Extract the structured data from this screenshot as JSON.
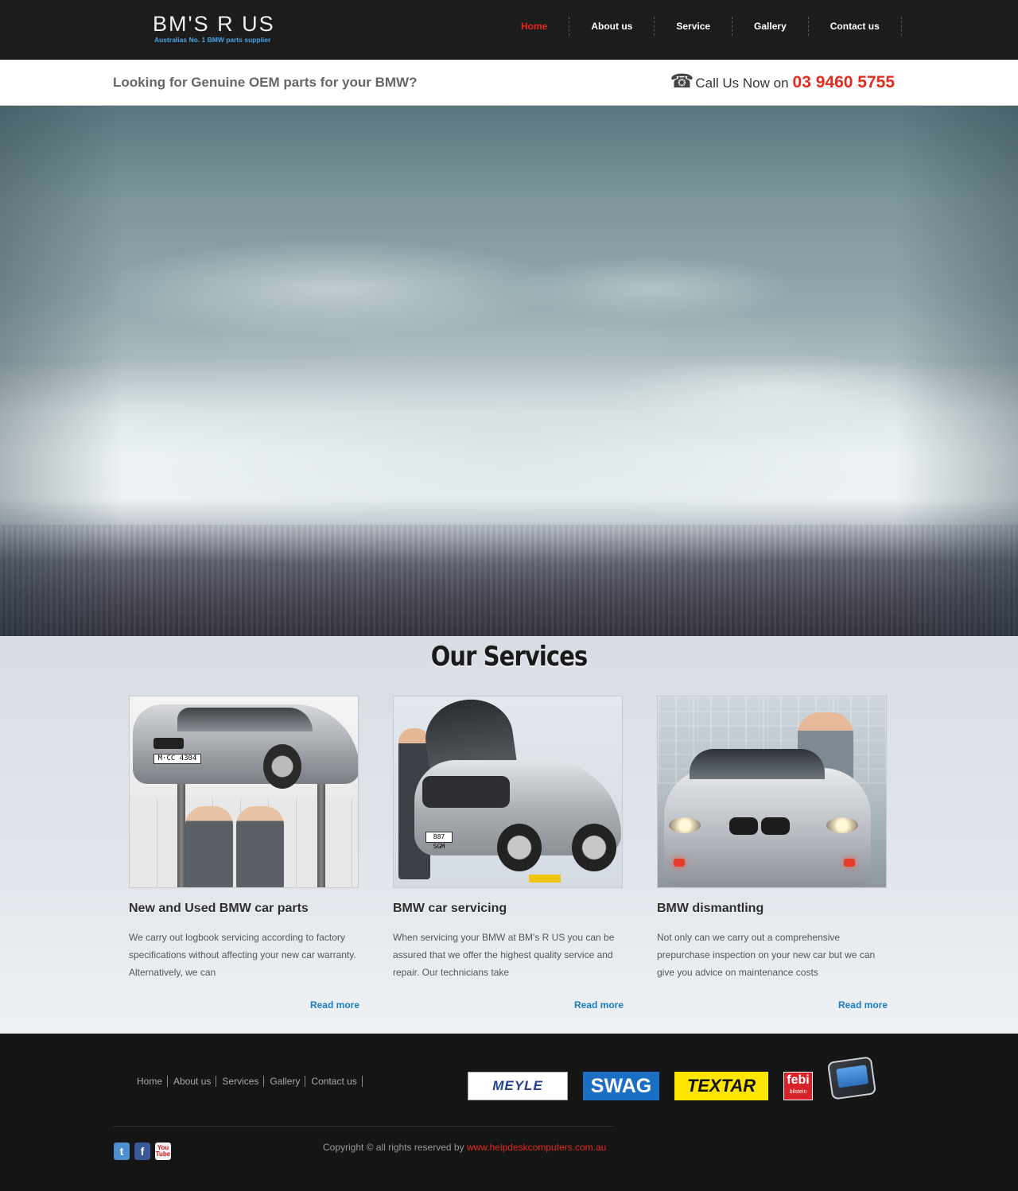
{
  "brand": {
    "logo_text": "BM'S R US",
    "tagline": "Australias No. 1 BMW parts supplier"
  },
  "nav": {
    "items": [
      {
        "label": "Home",
        "active": true
      },
      {
        "label": "About us",
        "active": false
      },
      {
        "label": "Service",
        "active": false
      },
      {
        "label": "Gallery",
        "active": false
      },
      {
        "label": "Contact us",
        "active": false
      }
    ]
  },
  "strip": {
    "question": "Looking for Genuine OEM parts for your BMW?",
    "call_prefix": "Call Us Now on",
    "phone": "03 9460 5755",
    "phone_icon": "telephone-icon"
  },
  "services": {
    "title": "Our Services",
    "cards": [
      {
        "title": "New and Used BMW car parts",
        "text": "We carry out logbook servicing according to factory specifications without affecting your new car warranty. Alternatively, we can",
        "more": "Read more",
        "plate": "M·CC 4304"
      },
      {
        "title": "BMW car servicing",
        "text": "When servicing your BMW at BM's R US you can be assured that we offer the highest quality service and repair. Our technicians take",
        "more": "Read more",
        "plate": "887 SGM"
      },
      {
        "title": "BMW dismantling",
        "text": "Not only can we carry out a comprehensive prepurchase inspection on your new car but we can give you advice on maintenance costs",
        "more": "Read more"
      }
    ]
  },
  "footer": {
    "links": [
      "Home",
      "About us",
      "Services",
      "Gallery",
      "Contact us"
    ],
    "brands": {
      "meyle": "MEYLE",
      "swag": "SWAG",
      "textar": "TEXTAR",
      "febi": "febi",
      "febi_sub": "bilstein"
    },
    "social": [
      "twitter-icon",
      "facebook-icon",
      "youtube-icon"
    ],
    "copyright": "Copyright © all rights reserved by",
    "copyright_link": "www.helpdeskcomputers.com.au"
  },
  "colors": {
    "accent_red": "#e22b1c",
    "link_blue": "#1a7cc7",
    "header_bg": "#1c1c1c",
    "footer_bg": "#151515"
  }
}
